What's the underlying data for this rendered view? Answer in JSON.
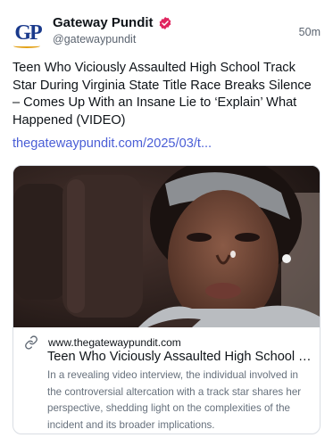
{
  "author": {
    "avatar_initials": "GP",
    "name": "Gateway Pundit",
    "handle": "@gatewaypundit",
    "verified_icon": "verified-badge-icon",
    "verified_color": "#e0245e"
  },
  "post": {
    "time": "50m",
    "text": "Teen Who Viciously Assaulted High School Track Star During Virginia State Title Race Breaks Silence – Comes Up With an Insane Lie to ‘Explain’ What Happened (VIDEO)",
    "link_text": "thegatewaypundit.com/2025/03/t..."
  },
  "card": {
    "domain": "www.thegatewaypundit.com",
    "title": "Teen Who Viciously Assaulted High School Tra...",
    "description": "In a revealing video interview, the individual involved in the controversial altercation with a track star shares her perspective, shedding light on the complexities of the incident and its broader implications.",
    "link_icon": "link-icon"
  },
  "colors": {
    "link": "#4a5ed6",
    "muted": "#5b6470",
    "avatar_blue": "#1a3a8c",
    "avatar_gold": "#e3a21a"
  }
}
